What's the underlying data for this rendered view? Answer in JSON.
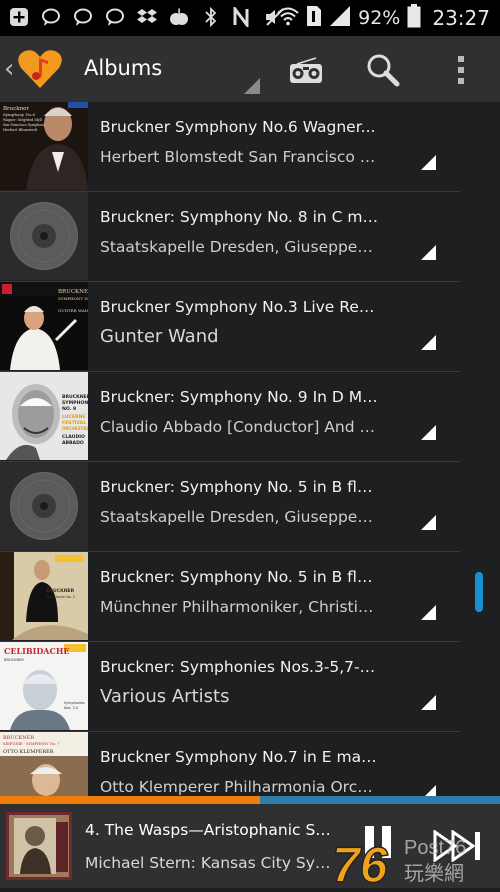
{
  "status_bar": {
    "icons": [
      "add-box-icon",
      "chat-bubble-icon",
      "chat-bubble-icon",
      "chat-bubble-icon",
      "dropbox-icon",
      "apple-icon",
      "bluetooth-icon",
      "nfc-icon",
      "mute-icon",
      "wifi-icon",
      "sim-1-icon",
      "signal-icon"
    ],
    "battery": "92%",
    "time": "23:27"
  },
  "header": {
    "title": "Albums"
  },
  "albums": [
    {
      "title": "Bruckner  Symphony No.6   Wagner...",
      "artist": "Herbert Blomstedt  San Francisco S...",
      "art": "blomstedt",
      "big": false
    },
    {
      "title": "Bruckner: Symphony No. 8 in C min...",
      "artist": "Staatskapelle Dresden, Giuseppe Si...",
      "art": "disc",
      "big": false
    },
    {
      "title": "Bruckner Symphony No.3 Live Recor...",
      "artist": "Gunter Wand",
      "art": "wand",
      "big": true
    },
    {
      "title": "Bruckner: Symphony No. 9 In D Min...",
      "artist": "Claudio Abbado [Conductor] And Lu...",
      "art": "abbado",
      "big": false
    },
    {
      "title": "Bruckner: Symphony No. 5 in B flat...",
      "artist": "Staatskapelle Dresden, Giuseppe Si...",
      "art": "disc",
      "big": false
    },
    {
      "title": "Bruckner: Symphony No. 5 in B flat...",
      "artist": "Münchner Philharmoniker, Christian...",
      "art": "thielemann",
      "big": false
    },
    {
      "title": "Bruckner: Symphonies Nos.3-5,7-9 [...",
      "artist": "Various Artists",
      "art": "celibidache",
      "big": true
    },
    {
      "title": "Bruckner  Symphony No.7 in E majo...",
      "artist": "Otto Klemperer  Philharmonia Orche...",
      "art": "klemperer",
      "big": false
    }
  ],
  "art_text": {
    "blomstedt": [
      "Bruckner",
      "Symphony No.6",
      "Wagner: Siegfried Idyll",
      "San Francisco Symphony",
      "Herbert Blomstedt"
    ],
    "wand": [
      "BRUCKNER",
      "SYMPHONY No.3",
      "GUNTER WAND"
    ],
    "abbado": [
      "BRUCKNER",
      "SYMPHONY",
      "NO. 9",
      "LUCERNE",
      "FESTIVAL",
      "ORCHESTRA",
      "CLAUDIO",
      "ABBADO"
    ],
    "thielemann": [
      "BRUCKNER",
      "Symphonie No. 5"
    ],
    "celibidache": [
      "CELIBIDACHE",
      "BRUCKNER",
      "Symphonies",
      "Nos. 3-5"
    ],
    "klemperer": [
      "BRUCKNER",
      "SINFONIE · SYMPHONY No. 7",
      "OTTO KLEMPERER"
    ]
  },
  "now_playing": {
    "title": "4. The Wasps—Aristophanic Sui...",
    "subtitle": "Michael Stern: Kansas City Sym...",
    "progress": 0.52
  },
  "watermark": {
    "number": "76",
    "brand": "Post76",
    "cjk": "玩樂網"
  },
  "colors": {
    "accent_blue": "#1a8fd6",
    "progress_orange": "#ef7d0b",
    "progress_track": "#2a7fa8",
    "logo_orange": "#f39a1e"
  }
}
